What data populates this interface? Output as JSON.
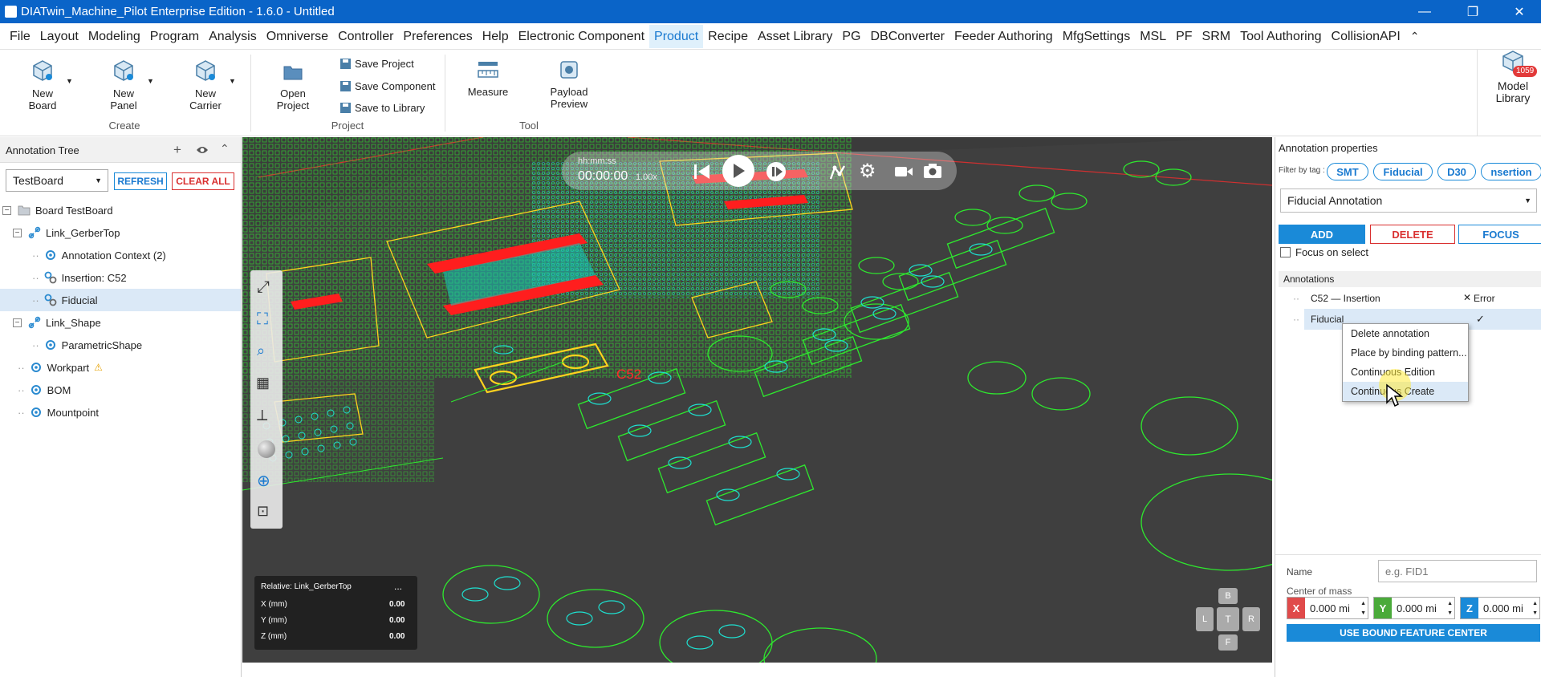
{
  "window": {
    "title": "DIATwin_Machine_Pilot Enterprise Edition - 1.6.0 - Untitled",
    "minimize_glyph": "—",
    "restore_glyph": "❐",
    "close_glyph": "✕"
  },
  "menu": {
    "items": [
      "File",
      "Layout",
      "Modeling",
      "Program",
      "Analysis",
      "Omniverse",
      "Controller",
      "Preferences",
      "Help",
      "Electronic Component",
      "Product",
      "Recipe",
      "Asset Library",
      "PG",
      "DBConverter",
      "Feeder Authoring",
      "MfgSettings",
      "MSL",
      "PF",
      "SRM",
      "Tool Authoring",
      "CollisionAPI"
    ],
    "active": "Product",
    "collapse_glyph": "⌃"
  },
  "ribbon": {
    "new_board": "New\nBoard",
    "new_panel": "New\nPanel",
    "new_carrier": "New\nCarrier",
    "group_create": "Create",
    "open_project": "Open\nProject",
    "save_project": "Save Project",
    "save_component": "Save Component",
    "save_to_library": "Save to Library",
    "group_project": "Project",
    "measure": "Measure",
    "payload_preview": "Payload\nPreview",
    "group_tool": "Tool",
    "model_library": "Model\nLibrary",
    "model_library_badge": "1059"
  },
  "annotation_tree": {
    "title": "Annotation Tree",
    "board_select": "TestBoard",
    "refresh": "REFRESH",
    "clear_all": "CLEAR ALL",
    "nodes": {
      "board": "Board  TestBoard",
      "link_gerbertop": "Link_GerberTop",
      "annotation_context": "Annotation Context (2)",
      "insertion": "Insertion: C52",
      "fiducial": "Fiducial",
      "link_shape": "Link_Shape",
      "parametric_shape": "ParametricShape",
      "workpart": "Workpart",
      "bom": "BOM",
      "mountpoint": "Mountpoint"
    }
  },
  "viewport": {
    "time_format": "hh:mm:ss",
    "time": "00:00:00",
    "speed": "1.00x",
    "label_c52": "C52",
    "coords": {
      "relative": "Relative: Link_GerberTop",
      "more": "...",
      "x_label": "X (mm)",
      "x_value": "0.00",
      "y_label": "Y (mm)",
      "y_value": "0.00",
      "z_label": "Z (mm)",
      "z_value": "0.00"
    },
    "navcube": {
      "b": "B",
      "l": "L",
      "t": "T",
      "r": "R",
      "f": "F"
    }
  },
  "annotation_properties": {
    "title": "Annotation properties",
    "filter_label": "Filter by tag :",
    "tags": [
      "SMT",
      "Fiducial",
      "D30",
      "nsertion"
    ],
    "type_select": "Fiducial Annotation",
    "add": "ADD",
    "delete": "DELETE",
    "focus": "FOCUS",
    "focus_on_select": "Focus on select",
    "annotations_header": "Annotations",
    "rows": [
      {
        "name": "C52 — Insertion",
        "status": "Error",
        "status_glyph": "✕"
      },
      {
        "name": "Fiducial",
        "status": "",
        "status_glyph": "✓"
      }
    ],
    "context_menu": [
      "Delete annotation",
      "Place by binding pattern...",
      "Continuous Edition",
      "Continuous Create"
    ],
    "name_label": "Name",
    "name_placeholder": "e.g. FID1",
    "center_of_mass": "Center of mass",
    "x_label": "X",
    "x_value": "0.000 mi",
    "y_label": "Y",
    "y_value": "0.000 mi",
    "z_label": "Z",
    "z_value": "0.000 mi",
    "use_bound": "USE BOUND FEATURE CENTER"
  },
  "colors": {
    "titlebar": "#0a64c8",
    "accent": "#1a8ad8",
    "danger": "#d93030",
    "viewport_bg": "#3b3b3b",
    "pcb_green": "#2ee82e",
    "pcb_yellow": "#ffd21e",
    "pcb_red": "#ff1e1e"
  }
}
